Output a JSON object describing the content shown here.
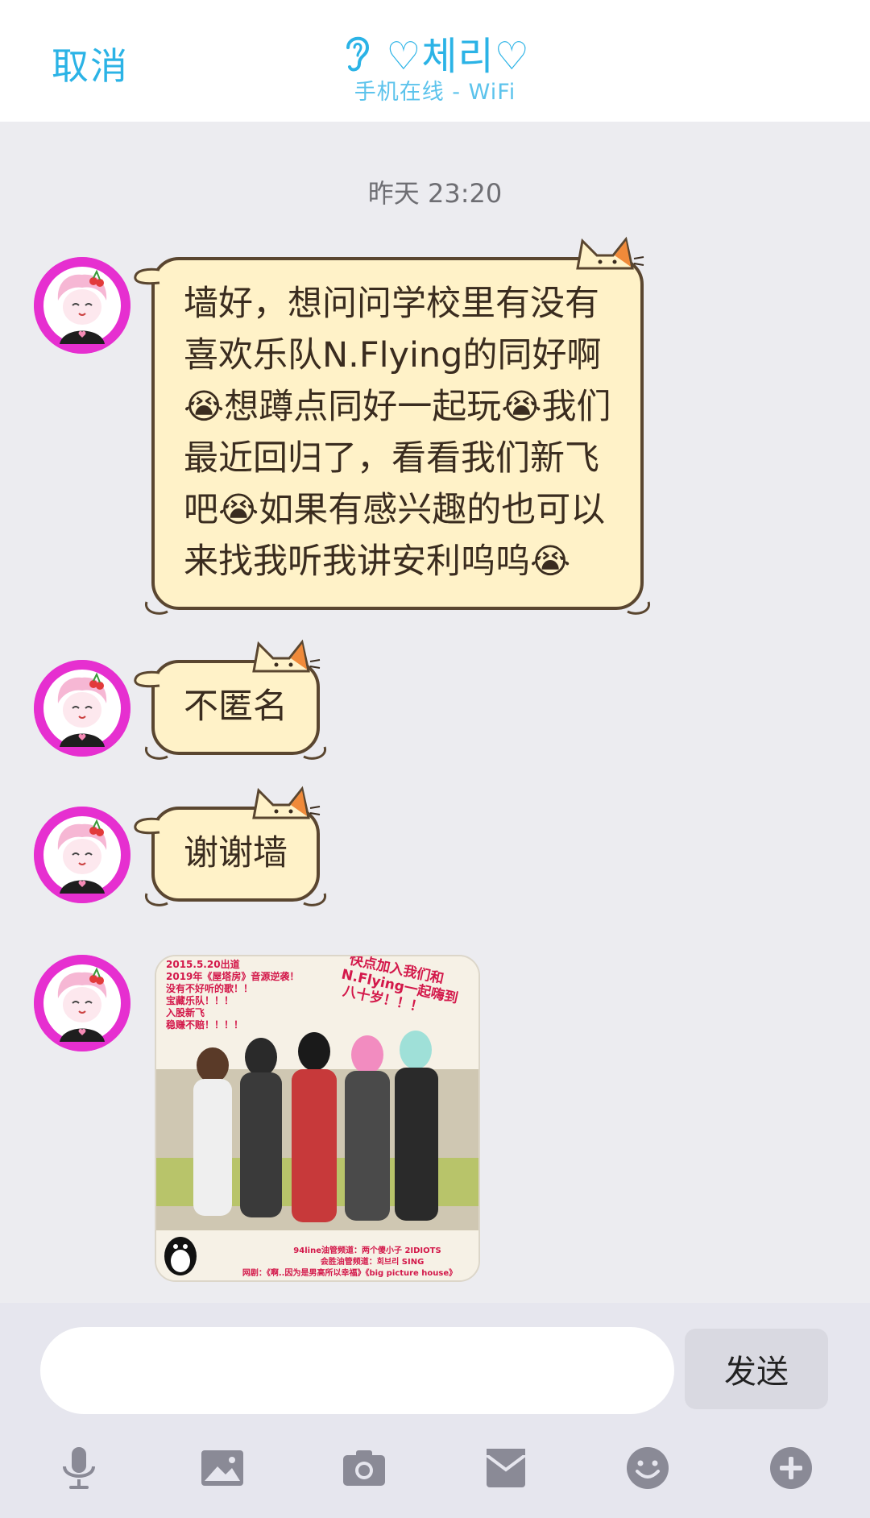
{
  "header": {
    "cancel_label": "取消",
    "title": "♡체리♡",
    "subtitle": "手机在线 - WiFi",
    "title_icon": "ear-icon",
    "accent_color": "#2bb3e6"
  },
  "chat": {
    "timestamp": "昨天 23:20",
    "messages": [
      {
        "type": "text",
        "text": "墙好，想问问学校里有没有\n喜欢乐队N.Flying的同好啊\n😭想蹲点同好一起玩😭我们\n最近回归了，看看我们新飞\n吧😭如果有感兴趣的也可以\n来找我听我讲安利呜呜😭"
      },
      {
        "type": "text",
        "text": "不匿名"
      },
      {
        "type": "text",
        "text": "谢谢墙"
      },
      {
        "type": "image",
        "image_text": {
          "top_left": [
            "2015.5.20出道",
            "2019年《屋塔房》音源逆袭！",
            "没有不好听的歌！！",
            "宝藏乐队！！！",
            "入股新飞",
            "稳赚不赔！！！！"
          ],
          "top_right": [
            "快点加入我们和",
            "N.Flying一起嗨到",
            "八十岁！！！"
          ],
          "bottom": [
            "94line油管频道：两个傻小子 2IDIOTS",
            "会胜油管频道：회브리 SING",
            "网剧：《啊..因为是男高所以幸福》《big picture house》"
          ]
        }
      }
    ],
    "bubble_color": "#fff2c8",
    "avatar_color": "#e62fd0"
  },
  "input": {
    "placeholder": "",
    "send_label": "发送"
  },
  "toolbar": {
    "icons": [
      "microphone-icon",
      "image-icon",
      "camera-icon",
      "envelope-icon",
      "emoji-icon",
      "plus-icon"
    ]
  }
}
